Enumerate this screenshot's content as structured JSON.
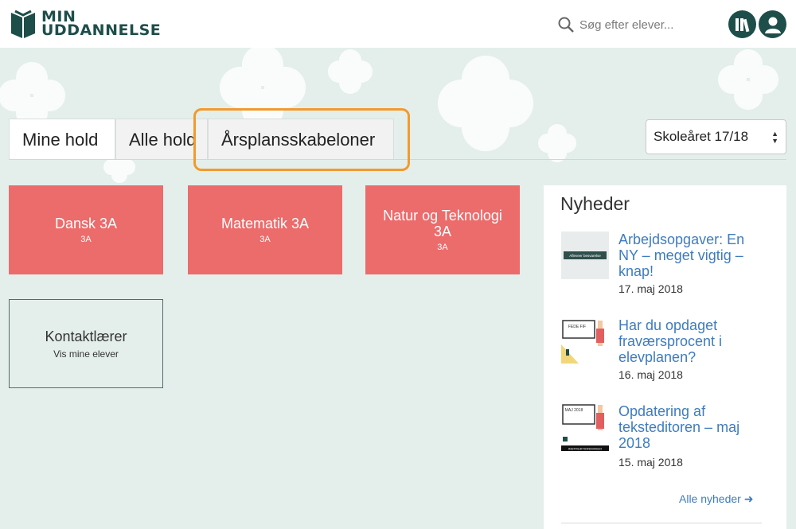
{
  "header": {
    "logo_line1": "MIN",
    "logo_line2": "UDDANNELSE",
    "search_placeholder": "Søg efter elever...",
    "icons": [
      "search-icon",
      "library-icon",
      "user-icon"
    ],
    "brand_color": "#1e4e4a"
  },
  "tabs": [
    {
      "label": "Mine hold",
      "active": true
    },
    {
      "label": "Alle hold",
      "active": false
    },
    {
      "label": "Årsplansskabeloner",
      "active": false,
      "highlighted": true
    }
  ],
  "year_select": {
    "value": "Skoleåret 17/18"
  },
  "cards": [
    {
      "title": "Dansk 3A",
      "subtitle": "3A"
    },
    {
      "title": "Matematik 3A",
      "subtitle": "3A"
    },
    {
      "title": "Natur og Teknologi 3A",
      "subtitle": "3A"
    }
  ],
  "contact_card": {
    "title": "Kontaktlærer",
    "subtitle": "Vis mine elever"
  },
  "news": {
    "heading": "Nyheder",
    "items": [
      {
        "title": "Arbejdsopgaver: En NY – meget vigtig – knap!",
        "date": "17. maj 2018",
        "thumb_text": "Afleveer besvarelse"
      },
      {
        "title": "Har du opdaget fraværsprocent i elevplanen?",
        "date": "16. maj 2018",
        "thumb_text": "FEDE FIF"
      },
      {
        "title": "Opdatering af teksteditoren – maj 2018",
        "date": "15. maj 2018",
        "thumb_text": "MAJ 2018",
        "thumb_text2": "INSTRUKTIONSVIDEO"
      }
    ],
    "all_link": "Alle nyheder"
  },
  "colors": {
    "card": "#ec6b6b",
    "link": "#3e7cbf",
    "highlight": "#f29a2e",
    "background": "#e4efec"
  }
}
